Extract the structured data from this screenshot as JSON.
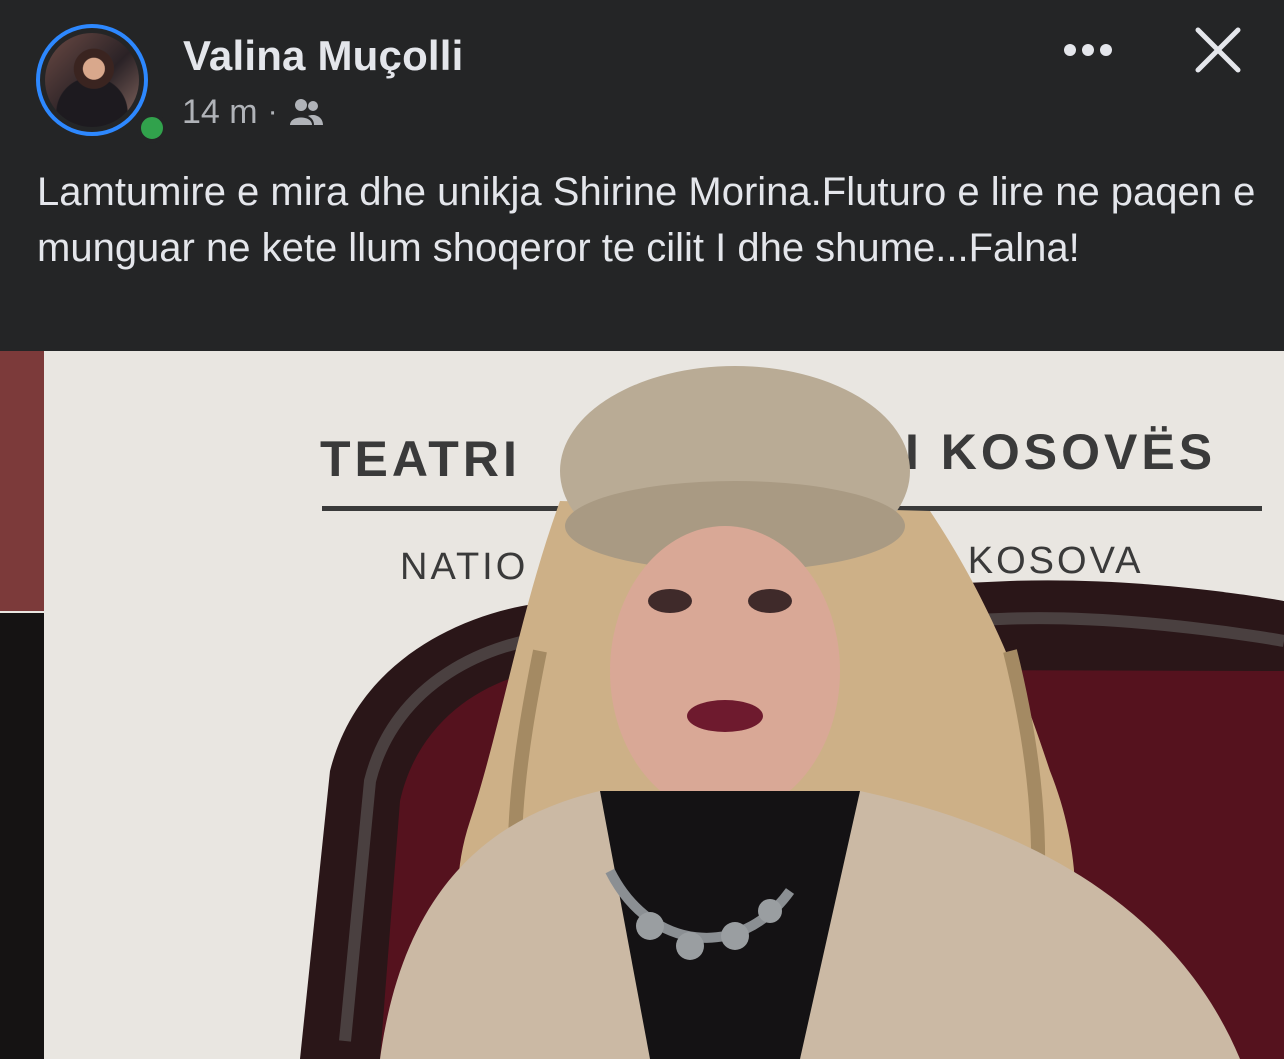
{
  "post": {
    "author_name": "Valina Muçolli",
    "time": "14 m",
    "separator": "·",
    "audience_icon": "friends-icon",
    "text": "Lamtumire e mira dhe unikja Shirine Morina.Fluturo e lire ne paqen e munguar ne kete llum shoqeror te cilit I dhe shume...Falna!"
  },
  "header_actions": {
    "more_icon": "more-options-icon",
    "close_icon": "close-icon"
  },
  "photo": {
    "banner_line1_left": "TEATRI",
    "banner_line1_right": "I KOSOVËS",
    "banner_line2_left": "NATIO",
    "banner_line2_right": "F KOSOVA"
  },
  "colors": {
    "background": "#242526",
    "text": "#e4e6eb",
    "secondary_text": "#b0b3b8",
    "avatar_ring": "#2d88ff",
    "online": "#31a24c"
  }
}
